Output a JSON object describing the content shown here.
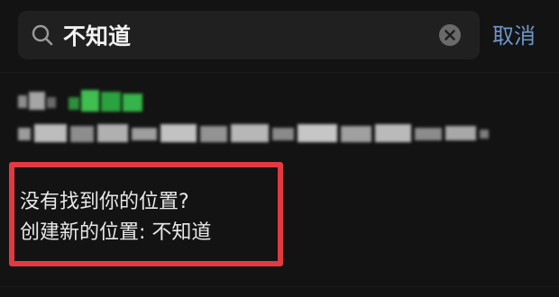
{
  "search": {
    "query": "不知道"
  },
  "header": {
    "cancel_label": "取消"
  },
  "create_location": {
    "not_found_text": "没有找到你的位置?",
    "create_text": "创建新的位置: 不知道"
  },
  "icons": {
    "search": "search-icon",
    "clear": "clear-icon"
  },
  "colors": {
    "accent": "#6f95c8",
    "highlight_border": "#e23a40",
    "background": "#131313"
  }
}
